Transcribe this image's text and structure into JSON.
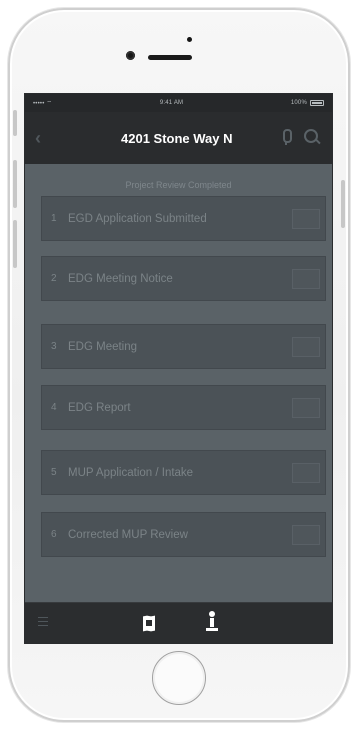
{
  "status_bar": {
    "carrier": "••••• ⌔",
    "time": "9:41 AM",
    "battery": "100%"
  },
  "nav": {
    "back_icon": "‹",
    "title": "4201 Stone Way N"
  },
  "content": {
    "banner": "Project Review Completed",
    "steps": [
      {
        "number": "1",
        "label": "EGD Application Submitted"
      },
      {
        "number": "2",
        "label": "EDG Meeting Notice"
      },
      {
        "number": "3",
        "label": "EDG Meeting"
      },
      {
        "number": "4",
        "label": "EDG Report"
      },
      {
        "number": "5",
        "label": "MUP Application / Intake"
      },
      {
        "number": "6",
        "label": "Corrected MUP Review"
      }
    ]
  },
  "tab_bar": {
    "items": [
      "menu-icon",
      "map-icon",
      "person-icon"
    ]
  },
  "colors": {
    "screen_bg": "#5a6267",
    "nav_bg": "#2a2c2e",
    "step_bg": "#4b5257",
    "tab_bar_bg": "#2b2d2f"
  }
}
